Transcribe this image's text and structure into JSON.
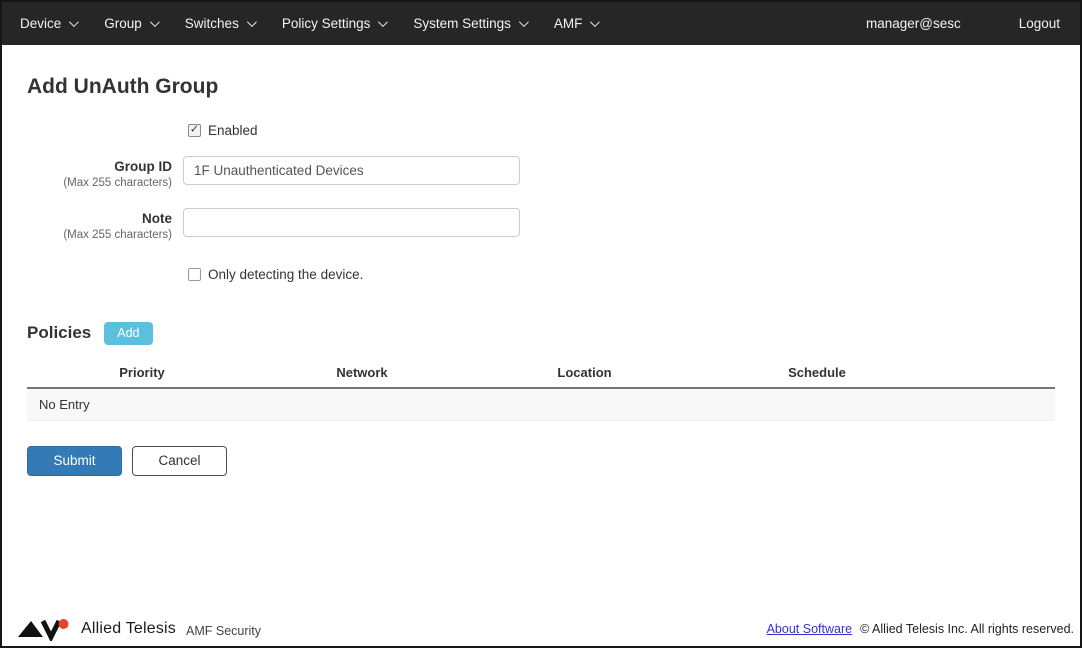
{
  "nav": {
    "items": [
      {
        "label": "Device"
      },
      {
        "label": "Group"
      },
      {
        "label": "Switches"
      },
      {
        "label": "Policy Settings"
      },
      {
        "label": "System Settings"
      },
      {
        "label": "AMF"
      }
    ],
    "user": "manager@sesc",
    "logout_label": "Logout"
  },
  "page": {
    "title": "Add UnAuth Group"
  },
  "form": {
    "enabled": {
      "label": "Enabled",
      "checked": true
    },
    "group_id": {
      "label": "Group ID",
      "hint": "(Max 255 characters)",
      "value": "1F Unauthenticated Devices"
    },
    "note": {
      "label": "Note",
      "hint": "(Max 255 characters)",
      "value": ""
    },
    "only_detecting": {
      "label": "Only detecting the device.",
      "checked": false
    }
  },
  "policies": {
    "heading": "Policies",
    "add_label": "Add",
    "columns": [
      "Priority",
      "Network",
      "Location",
      "Schedule"
    ],
    "empty_text": "No Entry"
  },
  "actions": {
    "submit_label": "Submit",
    "cancel_label": "Cancel"
  },
  "footer": {
    "brand": "Allied Telesis",
    "product": "AMF Security",
    "about_link": "About Software",
    "copyright": "© Allied Telesis Inc. All rights reserved."
  },
  "icons": {
    "check": "✓"
  },
  "colors": {
    "nav_bg": "#262626",
    "add_button": "#5bc0de",
    "submit_button": "#337ab7",
    "link": "#3333cc",
    "logo_red": "#e8412c"
  }
}
